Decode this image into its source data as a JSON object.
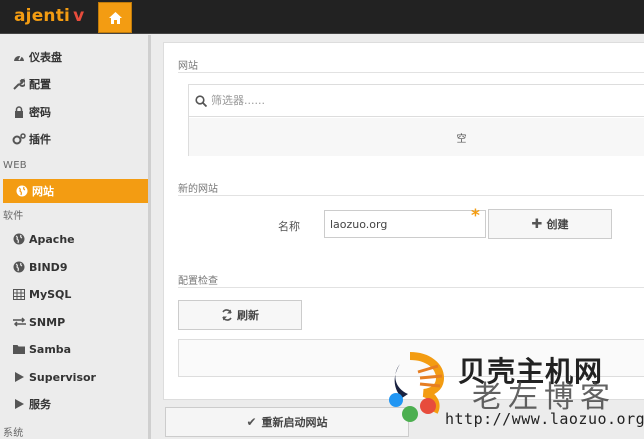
{
  "app": {
    "logo_text": "ajenti",
    "logo_accent": "v"
  },
  "colors": {
    "accent": "#f39c12",
    "topbar": "#222222",
    "logo_accent": "#e74c3c"
  },
  "sidebar": {
    "items": [
      {
        "label": "仪表盘",
        "icon": "dashboard-icon"
      },
      {
        "label": "配置",
        "icon": "wrench-icon"
      },
      {
        "label": "密码",
        "icon": "lock-icon"
      },
      {
        "label": "插件",
        "icon": "cogs-icon"
      }
    ],
    "section_web": "WEB",
    "web_items": [
      {
        "label": "网站",
        "icon": "globe-icon",
        "active": true
      }
    ],
    "section_software": "软件",
    "software_items": [
      {
        "label": "Apache",
        "icon": "globe-icon"
      },
      {
        "label": "BIND9",
        "icon": "globe-icon"
      },
      {
        "label": "MySQL",
        "icon": "table-icon"
      },
      {
        "label": "SNMP",
        "icon": "exchange-icon"
      },
      {
        "label": "Samba",
        "icon": "folder-icon"
      },
      {
        "label": "Supervisor",
        "icon": "play-icon"
      },
      {
        "label": "服务",
        "icon": "play-icon"
      }
    ],
    "section_system": "系统"
  },
  "main": {
    "websites_title": "网站",
    "search_placeholder": "筛选器......",
    "empty_text": "空",
    "new_site_title": "新的网站",
    "name_label": "名称",
    "name_value": "laozuo.org",
    "create_button": "创建",
    "config_check_title": "配置检查",
    "refresh_button": "刷新",
    "restart_button": "重新启动网站"
  },
  "watermark": {
    "title": "贝壳主机网",
    "subtitle": "老左博客",
    "url": "http://www.laozuo.org"
  }
}
